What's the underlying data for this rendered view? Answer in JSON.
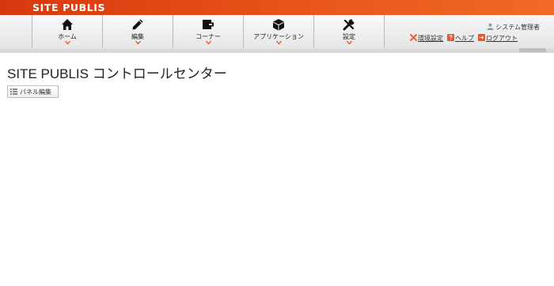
{
  "header": {
    "brand": "SITE PUBLIS"
  },
  "menu": [
    {
      "label": "ホーム",
      "icon": "home-icon"
    },
    {
      "label": "編集",
      "icon": "pencil-icon"
    },
    {
      "label": "コーナー",
      "icon": "corner-icon"
    },
    {
      "label": "アプリケーション",
      "icon": "cube-icon"
    },
    {
      "label": "設定",
      "icon": "wrench-icon"
    }
  ],
  "user": {
    "name": "システム管理者",
    "icon": "user-icon"
  },
  "tools": {
    "env_settings": "環境設定",
    "help": "ヘルプ",
    "logout": "ログアウト"
  },
  "main": {
    "title": "SITE PUBLIS コントロールセンター",
    "panel_edit_label": "パネル編集"
  },
  "colors": {
    "brand_orange": "#e8551a",
    "text": "#222222"
  }
}
